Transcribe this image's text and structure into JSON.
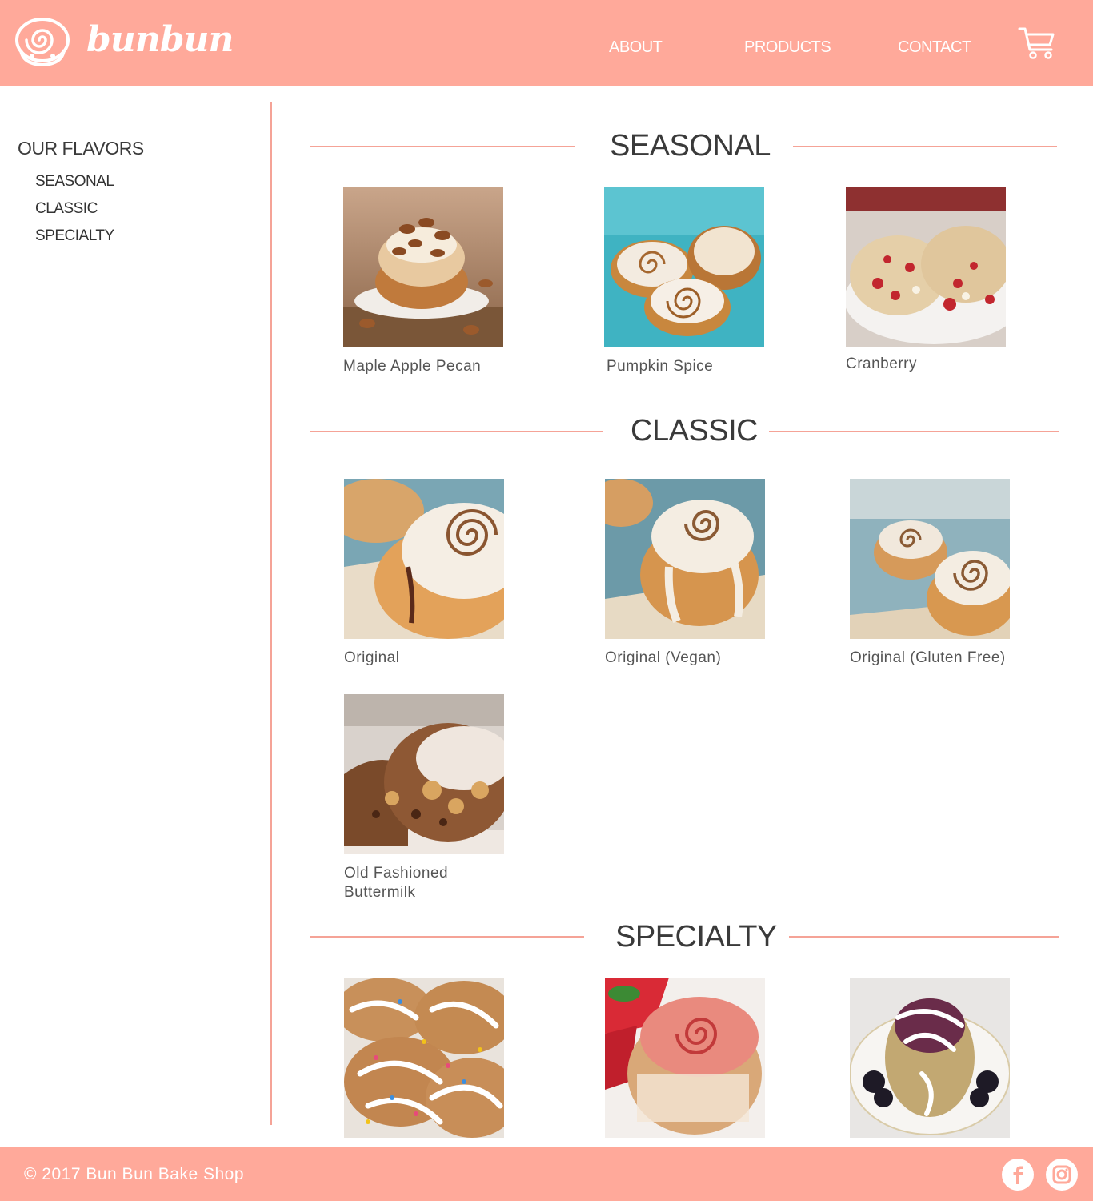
{
  "brand": {
    "name": "bunbun"
  },
  "nav": {
    "about": "ABOUT",
    "products": "PRODUCTS",
    "contact": "CONTACT"
  },
  "sidebar": {
    "title": "OUR FLAVORS",
    "items": [
      "SEASONAL",
      "CLASSIC",
      "SPECIALTY"
    ]
  },
  "sections": {
    "seasonal": {
      "title": "SEASONAL",
      "items": [
        "Maple Apple Pecan",
        "Pumpkin Spice",
        "Cranberry"
      ]
    },
    "classic": {
      "title": "CLASSIC",
      "items": [
        "Original",
        "Original (Vegan)",
        "Original (Gluten Free)",
        "Old Fashioned Buttermilk"
      ]
    },
    "specialty": {
      "title": "SPECIALTY"
    }
  },
  "footer": {
    "copyright": "© 2017 Bun Bun Bake Shop"
  },
  "colors": {
    "brand": "#ffa99a",
    "rule": "#f5a397",
    "text": "#3a3a3a"
  }
}
